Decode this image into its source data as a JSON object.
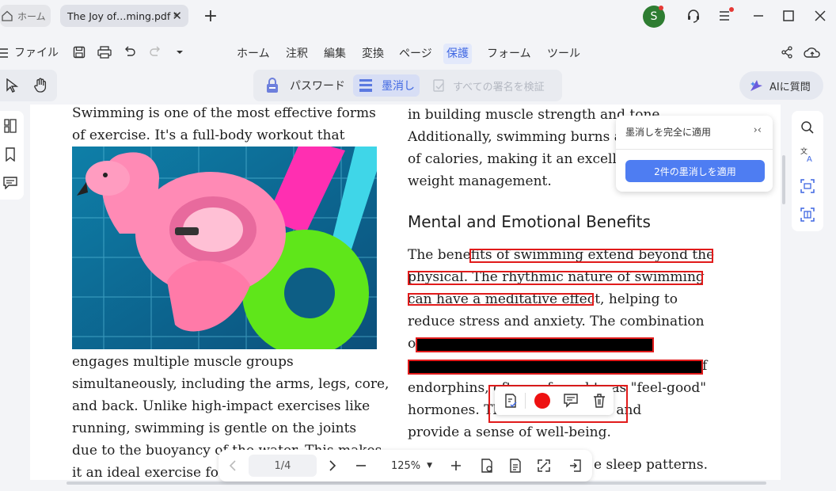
{
  "tabs": {
    "home_label": "ホーム",
    "doc_label": "The Joy of…ming.pdf *"
  },
  "titlebar": {
    "avatar_letter": "S",
    "colors": {
      "avatar": "#2e7d32",
      "notify_dot": "#e53935"
    }
  },
  "menubar": {
    "file_label": "ファイル",
    "items": [
      "ホーム",
      "注釈",
      "編集",
      "変換",
      "ページ",
      "保護",
      "フォーム",
      "ツール"
    ],
    "active_index": 5
  },
  "protect_toolbar": {
    "password_label": "パスワード",
    "redact_label": "墨消し",
    "verify_label": "すべての署名を検証"
  },
  "ai_button": {
    "label": "AIに質問"
  },
  "document": {
    "left_column": {
      "top_lines": [
        "Swimming is one of the most effective forms",
        "of exercise. It's a full-body workout that"
      ],
      "bottom_lines": [
        "engages multiple muscle groups",
        "simultaneously, including the arms, legs, core,",
        "and back. Unlike high-impact exercises like",
        "running, swimming is gentle on the joints",
        "due to the buoyancy of the water. This makes",
        "it an ideal exercise for"
      ]
    },
    "right_column": {
      "top_lines": [
        "in building muscle strength and tone.",
        "Additionally, swimming burns a",
        "of calories, making it an excelle",
        "weight management."
      ],
      "heading": "Mental and Emotional Benefits",
      "body_lines": [
        "The benefits of swimming extend beyond the",
        "physical. The rhythmic nature of swimming",
        "can have a meditative effect, helping to",
        "reduce stress and anxiety. The combination",
        "o",
        "f",
        "endorphins, often referred to as \"feel-good\"",
        "hormones. Th                    ood and",
        "provide a sense of well-being."
      ],
      "last_line": "e sleep patterns."
    },
    "image_alt": "pink flamingo pool float with green ring and colorful floats"
  },
  "redact_popover": {
    "title": "墨消しを完全に適用",
    "apply_button": "2件の墨消しを適用"
  },
  "mini_toolbar": {
    "colors": {
      "fill": "#ee1111"
    }
  },
  "bottom_nav": {
    "page_indicator": "1/4",
    "zoom": "125%"
  }
}
